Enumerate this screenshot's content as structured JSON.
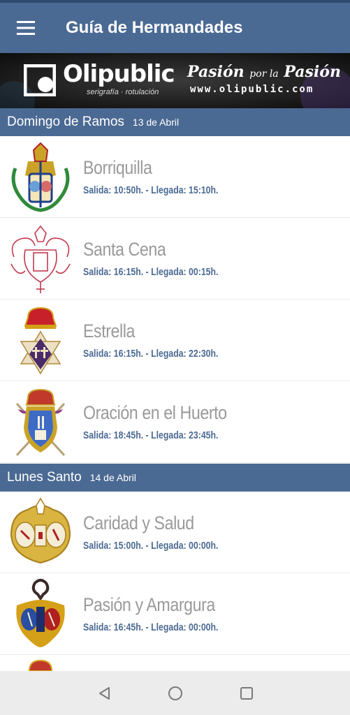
{
  "app_bar": {
    "title": "Guía de Hermandades",
    "menu_icon": "menu-icon"
  },
  "banner": {
    "brand": "Olipublic",
    "subtitle": "serigrafía · rotulación",
    "slogan_a": "Pasión",
    "slogan_b": "por la",
    "slogan_c": "Pasión",
    "url": "www.olipublic.com"
  },
  "sections": [
    {
      "day": "Domingo de Ramos",
      "date": "13 de Abril"
    },
    {
      "day": "Lunes Santo",
      "date": "14 de Abril"
    }
  ],
  "items": [
    {
      "name": "Borriquilla",
      "times": "Salida: 10:50h. - Llegada: 15:10h.",
      "crest_icon": "crest-borriquilla-icon"
    },
    {
      "name": "Santa Cena",
      "times": "Salida: 16:15h. - Llegada: 00:15h.",
      "crest_icon": "crest-santa-cena-icon"
    },
    {
      "name": "Estrella",
      "times": "Salida: 16:15h. - Llegada: 22:30h.",
      "crest_icon": "crest-estrella-icon"
    },
    {
      "name": "Oración en el Huerto",
      "times": "Salida: 18:45h. - Llegada: 23:45h.",
      "crest_icon": "crest-oracion-icon"
    },
    {
      "name": "Caridad y Salud",
      "times": "Salida: 15:00h. - Llegada: 00:00h.",
      "crest_icon": "crest-caridad-icon"
    },
    {
      "name": "Pasión y Amargura",
      "times": "Salida: 16:45h. - Llegada: 00:00h.",
      "crest_icon": "crest-pasion-icon"
    }
  ],
  "nav": {
    "back": "back-icon",
    "home": "home-icon",
    "recents": "recents-icon"
  },
  "colors": {
    "primary": "#4b6a93",
    "text_muted": "#9a9a9a",
    "accent_text": "#4b6a93"
  }
}
